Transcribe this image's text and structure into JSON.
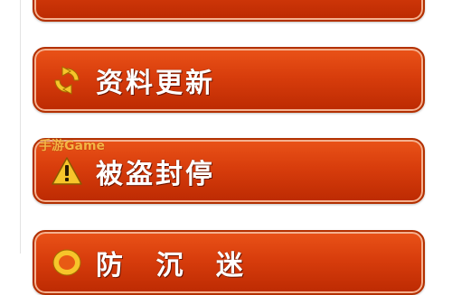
{
  "menu": {
    "items": [
      {
        "label": "",
        "icon": "partial-icon"
      },
      {
        "label": "资料更新",
        "icon": "refresh-icon"
      },
      {
        "label": "被盗封停",
        "icon": "warning-icon"
      },
      {
        "label": "防 沉 迷",
        "icon": "shield-icon"
      }
    ]
  },
  "watermark": {
    "text": "手游Game"
  },
  "colors": {
    "button_top": "#ea5318",
    "button_bottom": "#bc2a02",
    "button_border": "#b33000",
    "icon_yellow": "#f7c52a",
    "label": "#ffffff"
  }
}
